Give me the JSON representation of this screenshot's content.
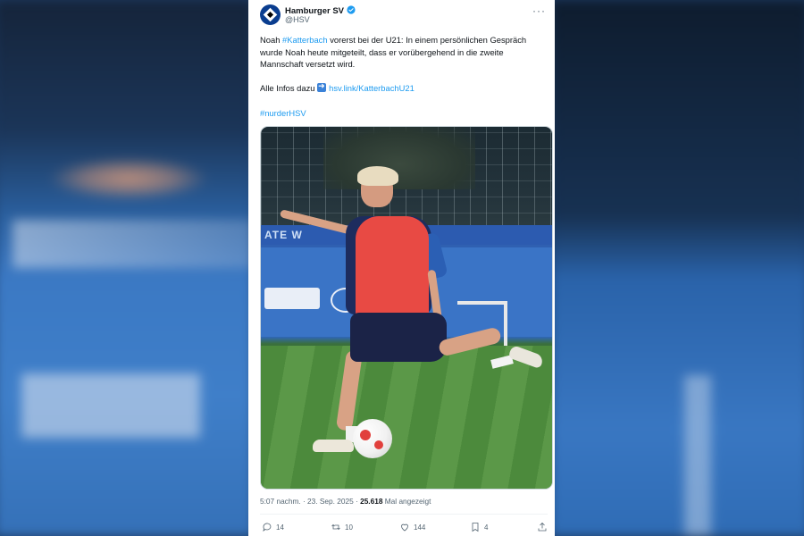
{
  "tweet": {
    "author_name": "Hamburger SV",
    "author_handle": "@HSV",
    "more_icon": "more-horizontal-icon",
    "text_prefix": "Noah ",
    "hashtag_katterbach": "#Katterbach",
    "text_rest": " vorerst bei der U21: In einem persönlichen Gespräch wurde Noah heute mitgeteilt, dass er vorübergehend in die zweite Mannschaft versetzt wird.",
    "infos_label": "Alle Infos dazu ",
    "infos_link": "hsv.link/KatterbachU21",
    "hashtag_nurderhsv": "#nurderHSV",
    "timestamp": "5:07 nachm. · 23. Sep. 2025 · ",
    "views_count": "25.618",
    "views_label": " Mal angezeigt"
  },
  "media": {
    "board_text": "ATE W"
  },
  "actions": {
    "replies": "14",
    "retweets": "10",
    "likes": "144",
    "bookmarks": "4"
  },
  "colors": {
    "link": "#1d9bf0",
    "verified": "#1d9bf0",
    "text": "#0f1419",
    "muted": "#536471"
  }
}
